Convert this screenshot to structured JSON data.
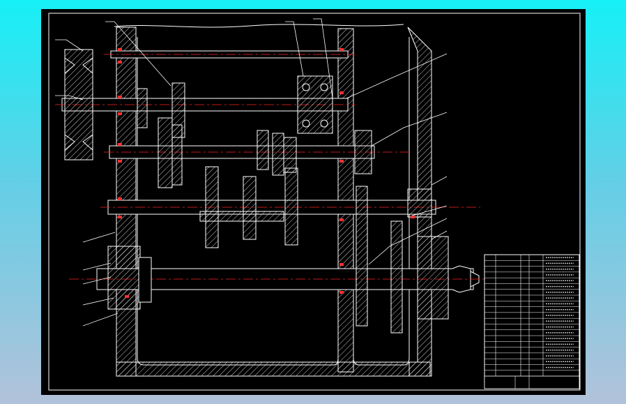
{
  "drawing": {
    "type": "gearbox assembly drawing (CAD)",
    "colors": {
      "background": "#000000",
      "outline": "#ffffff",
      "centerline": "#ff2020",
      "hatch": "#ffffff",
      "seal": "#ff3030"
    }
  },
  "title_block": {
    "rows": 21,
    "illegible_text": true
  }
}
